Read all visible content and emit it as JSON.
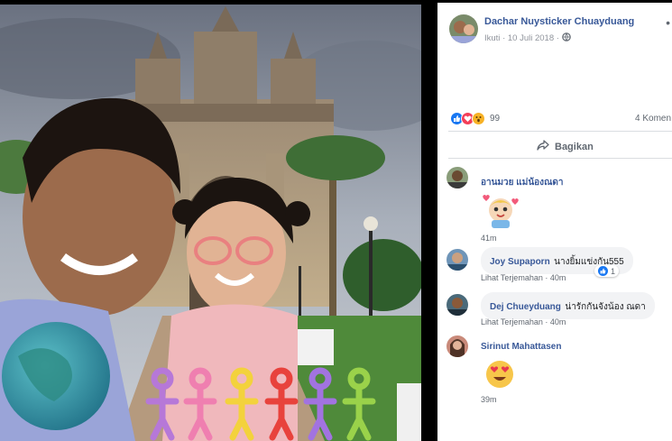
{
  "post": {
    "author": "Dachar Nuysticker Chuayduang",
    "follow": "Ikuti",
    "date": "10 Juli 2018",
    "dot": "·",
    "more": "•",
    "reaction_count": "99",
    "comment_count": "4 Komen",
    "share_label": "Bagikan"
  },
  "comments": [
    {
      "name": "อานมวย แม่น้องณดา",
      "text": "",
      "time": "41m",
      "sticker": "baby-hearts-sticker"
    },
    {
      "name": "Joy Supaporn",
      "text": "นางยิ้มแข่งกัน555",
      "see_translation": "Lihat Terjemahan",
      "dot": "·",
      "time": "40m",
      "likes": "1"
    },
    {
      "name": "Dej Chueyduang",
      "text": "น่ารักกันจังน้อง ณดา",
      "see_translation": "Lihat Terjemahan",
      "dot": "·",
      "time": "40m"
    },
    {
      "name": "Sirinut Mahattasen",
      "text": "",
      "time": "39m",
      "sticker": "heart-eyes-emoji"
    }
  ],
  "colors": {
    "link": "#385898",
    "meta": "#90949c",
    "like": "#1877f2",
    "love": "#f33e58",
    "wow": "#f7b125"
  },
  "icons": [
    "globe-icon",
    "share-icon",
    "like-reaction-icon",
    "love-reaction-icon",
    "wow-reaction-icon",
    "more-icon"
  ]
}
